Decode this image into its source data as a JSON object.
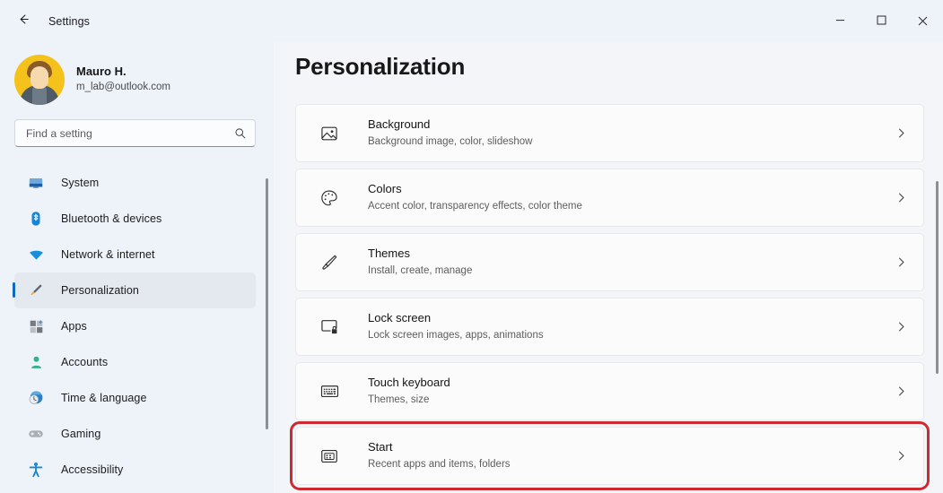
{
  "window": {
    "title": "Settings",
    "back_icon": "back-arrow-icon",
    "controls": [
      {
        "name": "minimize-button",
        "glyph": "minimize-icon"
      },
      {
        "name": "maximize-button",
        "glyph": "maximize-icon"
      },
      {
        "name": "close-button",
        "glyph": "close-icon"
      }
    ]
  },
  "sidebar": {
    "profile": {
      "name": "Mauro H.",
      "email": "m_lab@outlook.com",
      "avatar_icon": "user-avatar"
    },
    "search": {
      "placeholder": "Find a setting",
      "value": "",
      "icon": "search-icon"
    },
    "items": [
      {
        "label": "System",
        "icon": "system-monitor-icon",
        "selected": false
      },
      {
        "label": "Bluetooth & devices",
        "icon": "bluetooth-icon",
        "selected": false
      },
      {
        "label": "Network & internet",
        "icon": "wifi-icon",
        "selected": false
      },
      {
        "label": "Personalization",
        "icon": "paintbrush-icon",
        "selected": true
      },
      {
        "label": "Apps",
        "icon": "apps-grid-icon",
        "selected": false
      },
      {
        "label": "Accounts",
        "icon": "person-icon",
        "selected": false
      },
      {
        "label": "Time & language",
        "icon": "clock-globe-icon",
        "selected": false
      },
      {
        "label": "Gaming",
        "icon": "gamepad-icon",
        "selected": false
      },
      {
        "label": "Accessibility",
        "icon": "accessibility-person-icon",
        "selected": false
      }
    ]
  },
  "main": {
    "title": "Personalization",
    "cards": [
      {
        "title": "Background",
        "subtitle": "Background image, color, slideshow",
        "icon": "picture-icon",
        "highlighted": false
      },
      {
        "title": "Colors",
        "subtitle": "Accent color, transparency effects, color theme",
        "icon": "palette-icon",
        "highlighted": false
      },
      {
        "title": "Themes",
        "subtitle": "Install, create, manage",
        "icon": "paintbrush-icon",
        "highlighted": false
      },
      {
        "title": "Lock screen",
        "subtitle": "Lock screen images, apps, animations",
        "icon": "lock-screen-icon",
        "highlighted": false
      },
      {
        "title": "Touch keyboard",
        "subtitle": "Themes, size",
        "icon": "keyboard-icon",
        "highlighted": false
      },
      {
        "title": "Start",
        "subtitle": "Recent apps and items, folders",
        "icon": "start-menu-icon",
        "highlighted": true
      }
    ],
    "chevron_icon": "chevron-right-icon"
  },
  "colors": {
    "accent": "#0f6cbd",
    "highlight_border": "#cc2b32",
    "sidebar_bg": "#eef2f9",
    "main_bg": "#f3f5f9",
    "card_bg": "#fbfbfb"
  }
}
